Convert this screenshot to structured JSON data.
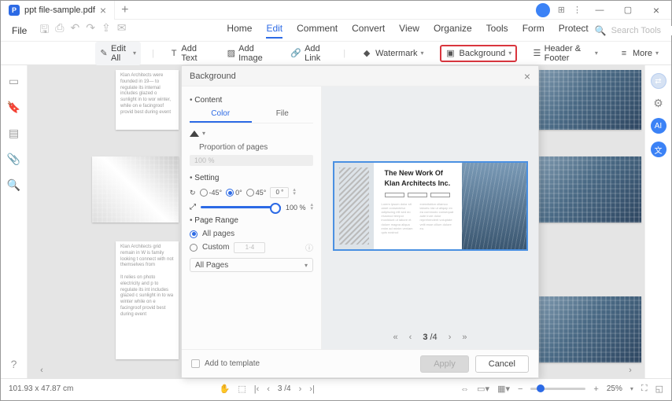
{
  "tab": {
    "title": "ppt file-sample.pdf"
  },
  "file_menu": "File",
  "menus": [
    "Home",
    "Edit",
    "Comment",
    "Convert",
    "View",
    "Organize",
    "Tools",
    "Form",
    "Protect"
  ],
  "active_menu": "Edit",
  "search": {
    "placeholder": "Search Tools"
  },
  "toolbar": {
    "edit_all": "Edit All",
    "add_text": "Add Text",
    "add_image": "Add Image",
    "add_link": "Add Link",
    "watermark": "Watermark",
    "background": "Background",
    "header_footer": "Header & Footer",
    "more": "More"
  },
  "dialog": {
    "title": "Background",
    "content_section": "Content",
    "subtabs": {
      "color": "Color",
      "file": "File"
    },
    "proportion": "Proportion of pages",
    "proportion_value": "100 %",
    "setting_section": "Setting",
    "angles": {
      "neg45": "-45°",
      "zero": "0°",
      "pos45": "45°",
      "custom": "0 °"
    },
    "opacity": "100 %",
    "page_range_section": "Page Range",
    "all_pages": "All pages",
    "custom": "Custom",
    "custom_value": "1-4",
    "selector": "All Pages",
    "add_template": "Add to template",
    "apply": "Apply",
    "cancel": "Cancel",
    "preview": {
      "title1": "The New Work Of",
      "title2": "Klan Architects Inc.",
      "page_cur": "3",
      "page_total": "/4"
    }
  },
  "status": {
    "dims": "101.93 x 47.87 cm",
    "page": "3 /4",
    "zoom": "25%"
  }
}
